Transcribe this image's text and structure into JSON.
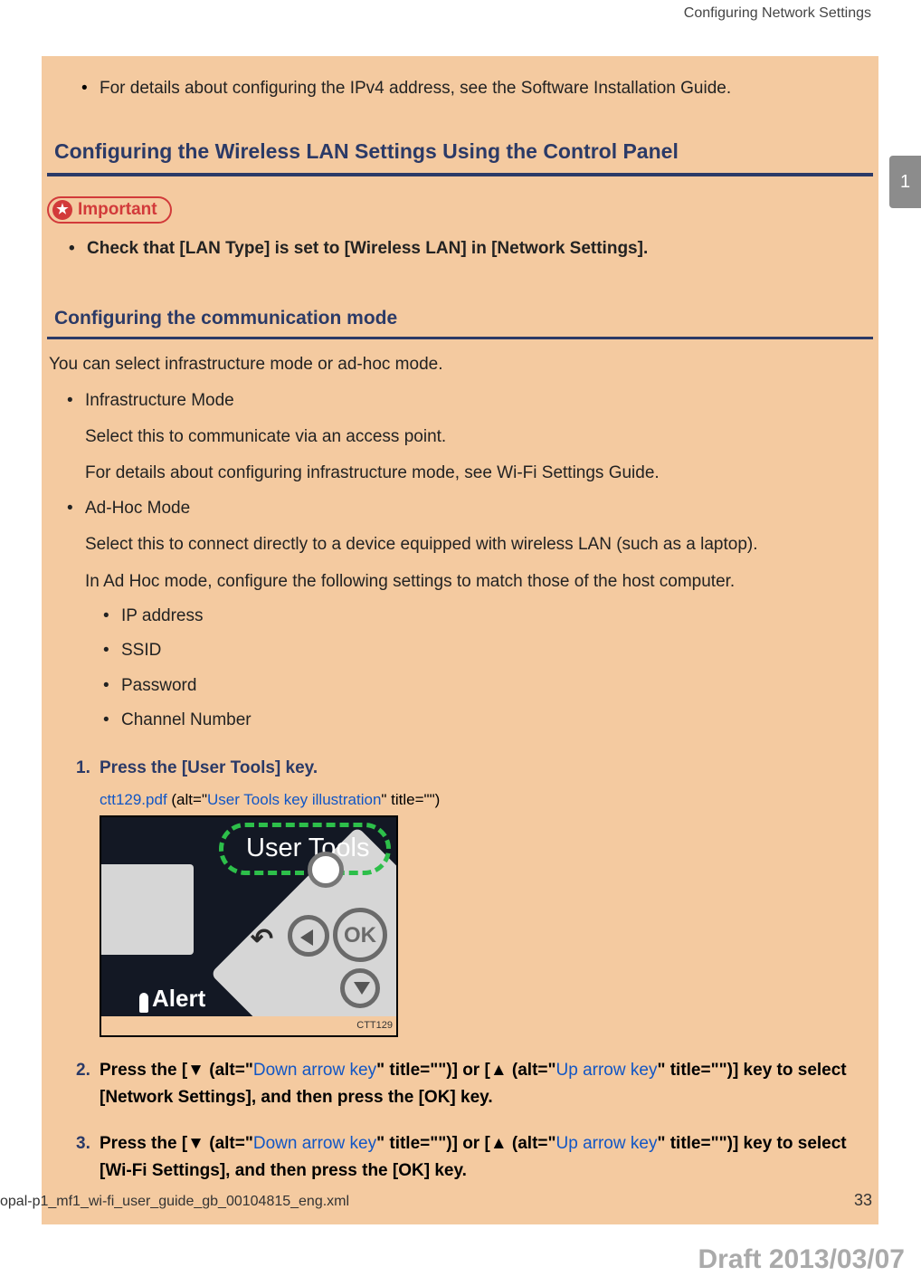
{
  "header": {
    "section_title": "Configuring Network Settings"
  },
  "side_tab": {
    "chapter": "1"
  },
  "note": {
    "text": "For details about configuring the IPv4 address, see the Software Installation Guide."
  },
  "h2": {
    "text": "Configuring the Wireless LAN Settings Using the Control Panel"
  },
  "important": {
    "label": "Important",
    "bullet": "Check that [LAN Type] is set to [Wireless LAN] in [Network Settings]."
  },
  "h3": {
    "text": "Configuring the communication mode"
  },
  "intro": "You can select infrastructure mode or ad-hoc mode.",
  "modes": {
    "infra": {
      "title": "Infrastructure Mode",
      "line1": "Select this to communicate via an access point.",
      "line2": "For details about configuring infrastructure mode, see Wi-Fi Settings Guide."
    },
    "adhoc": {
      "title": "Ad-Hoc Mode",
      "line1": "Select this to connect directly to a device equipped with wireless LAN (such as a laptop).",
      "line2": "In Ad Hoc mode, configure the following settings to match those of the host computer.",
      "subs": [
        "IP address",
        "SSID",
        "Password",
        "Channel Number"
      ]
    }
  },
  "steps": {
    "s1": {
      "num": "1.",
      "text": "Press the [User Tools] key.",
      "img_ref": {
        "file": "ctt129.pdf",
        "alt1": " (alt=\"",
        "alt_text": "User Tools key illustration",
        "alt2": "\" title=\"\")"
      },
      "figure": {
        "user_tools": "User Tools",
        "ok": "OK",
        "alert": "Alert",
        "caption": "CTT129"
      }
    },
    "s2": {
      "num": "2.",
      "p1": "Press the [",
      "down_sym": "▼",
      "alt_open": " (alt=\"",
      "down_alt": "Down arrow key",
      "alt_close": "\" title=\"\")",
      "mid": "] or [",
      "up_sym": "▲",
      "up_alt": "Up arrow key",
      "tail": "] key to select [Network Settings], and then press the [OK] key."
    },
    "s3": {
      "num": "3.",
      "p1": "Press the [",
      "down_sym": "▼",
      "alt_open": " (alt=\"",
      "down_alt": "Down arrow key",
      "alt_close": "\" title=\"\")",
      "mid": "] or [",
      "up_sym": "▲",
      "up_alt": "Up arrow key",
      "tail": "] key to select [Wi-Fi Settings], and then press the [OK] key."
    }
  },
  "footer": {
    "filename": "opal-p1_mf1_wi-fi_user_guide_gb_00104815_eng.xml",
    "page": "33",
    "draft": "Draft 2013/03/07"
  }
}
